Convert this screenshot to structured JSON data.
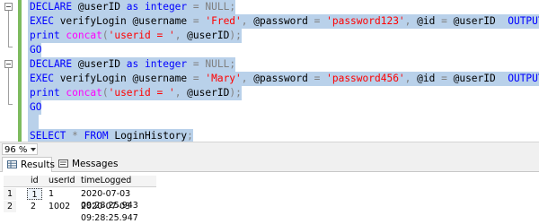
{
  "editor": {
    "lines": [
      [
        {
          "t": "DECLARE ",
          "c": "kw"
        },
        {
          "t": "@userID ",
          "c": "tx"
        },
        {
          "t": "as ",
          "c": "kw"
        },
        {
          "t": "integer ",
          "c": "kw"
        },
        {
          "t": "= ",
          "c": "op"
        },
        {
          "t": "NULL",
          "c": "op"
        },
        {
          "t": ";",
          "c": "op"
        }
      ],
      [
        {
          "t": "EXEC ",
          "c": "kw"
        },
        {
          "t": "verifyLogin @username ",
          "c": "tx"
        },
        {
          "t": "= ",
          "c": "op"
        },
        {
          "t": "'Fred'",
          "c": "str"
        },
        {
          "t": ", ",
          "c": "op"
        },
        {
          "t": "@password ",
          "c": "tx"
        },
        {
          "t": "= ",
          "c": "op"
        },
        {
          "t": "'password123'",
          "c": "str"
        },
        {
          "t": ", ",
          "c": "op"
        },
        {
          "t": "@id ",
          "c": "tx"
        },
        {
          "t": "= ",
          "c": "op"
        },
        {
          "t": "@userID  ",
          "c": "tx"
        },
        {
          "t": "OUTPUT",
          "c": "kw"
        },
        {
          "t": ";",
          "c": "op"
        }
      ],
      [
        {
          "t": "print ",
          "c": "kw"
        },
        {
          "t": "concat",
          "c": "fn"
        },
        {
          "t": "(",
          "c": "op"
        },
        {
          "t": "'userid = '",
          "c": "str"
        },
        {
          "t": ", ",
          "c": "op"
        },
        {
          "t": "@userID",
          "c": "tx"
        },
        {
          "t": ");",
          "c": "op"
        }
      ],
      [
        {
          "t": "GO",
          "c": "kw"
        }
      ],
      [
        {
          "t": "DECLARE ",
          "c": "kw"
        },
        {
          "t": "@userID ",
          "c": "tx"
        },
        {
          "t": "as ",
          "c": "kw"
        },
        {
          "t": "integer ",
          "c": "kw"
        },
        {
          "t": "= ",
          "c": "op"
        },
        {
          "t": "NULL",
          "c": "op"
        },
        {
          "t": ";",
          "c": "op"
        }
      ],
      [
        {
          "t": "EXEC ",
          "c": "kw"
        },
        {
          "t": "verifyLogin @username ",
          "c": "tx"
        },
        {
          "t": "= ",
          "c": "op"
        },
        {
          "t": "'Mary'",
          "c": "str"
        },
        {
          "t": ", ",
          "c": "op"
        },
        {
          "t": "@password ",
          "c": "tx"
        },
        {
          "t": "= ",
          "c": "op"
        },
        {
          "t": "'password456'",
          "c": "str"
        },
        {
          "t": ", ",
          "c": "op"
        },
        {
          "t": "@id ",
          "c": "tx"
        },
        {
          "t": "= ",
          "c": "op"
        },
        {
          "t": "@userID  ",
          "c": "tx"
        },
        {
          "t": "OUTPUT",
          "c": "kw"
        },
        {
          "t": ";",
          "c": "op"
        }
      ],
      [
        {
          "t": "print ",
          "c": "kw"
        },
        {
          "t": "concat",
          "c": "fn"
        },
        {
          "t": "(",
          "c": "op"
        },
        {
          "t": "'userid = '",
          "c": "str"
        },
        {
          "t": ", ",
          "c": "op"
        },
        {
          "t": "@userID",
          "c": "tx"
        },
        {
          "t": ");",
          "c": "op"
        }
      ],
      [
        {
          "t": "GO",
          "c": "kw"
        }
      ],
      [],
      [
        {
          "t": "SELECT ",
          "c": "kw"
        },
        {
          "t": "* ",
          "c": "op"
        },
        {
          "t": "FROM ",
          "c": "kw"
        },
        {
          "t": "LoginHistory",
          "c": "tx"
        },
        {
          "t": ";",
          "c": "op"
        }
      ]
    ],
    "colors": {
      "keyword": "#0000ff",
      "string": "#ff0000",
      "function": "#ff00ff",
      "operator": "#808080",
      "selection": "#b9d1ea",
      "change_bar": "#7dbb5e"
    }
  },
  "zoom": {
    "value": "96 %"
  },
  "tabs": {
    "results": "Results",
    "messages": "Messages"
  },
  "grid": {
    "columns": [
      "id",
      "userId",
      "timeLogged"
    ],
    "rows": [
      {
        "num": "1",
        "id": "1",
        "userId": "1",
        "timeLogged": "2020-07-03 09:28:25.943"
      },
      {
        "num": "2",
        "id": "2",
        "userId": "1002",
        "timeLogged": "2020-07-03 09:28:25.947"
      }
    ]
  }
}
